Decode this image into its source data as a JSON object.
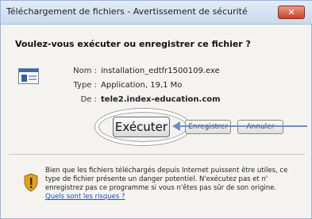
{
  "window": {
    "title": "Téléchargement de fichiers - Avertissement de sécurité",
    "close_glyph": "✕"
  },
  "heading": "Voulez-vous exécuter ou enregistrer ce fichier ?",
  "file": {
    "icon": "application-file-icon",
    "name_label": "Nom :",
    "name_value": "installation_edtfr1500109.exe",
    "type_label": "Type :",
    "type_value": "Application, 19,1 Mo",
    "from_label": "De :",
    "from_value": "tele2.index-education.com"
  },
  "buttons": {
    "run": "Exécuter",
    "save": "Enregistrer",
    "cancel": "Annuler"
  },
  "warning": {
    "icon": "shield-warning-icon",
    "lines": [
      "Bien que les fichiers téléchargés depuis Internet puissent être utiles, ce",
      "type de fichier présente un danger potentiel. N'exécutez pas et n'",
      "enregistrez pas ce programme si vous n'êtes pas sûr de son origine."
    ],
    "link": "Quels sont les risques ?"
  },
  "colors": {
    "arrow": "#6f8fc4",
    "titlebar": "#c9d8ee",
    "close_button": "#c8442b",
    "shield": "#e0a020"
  }
}
